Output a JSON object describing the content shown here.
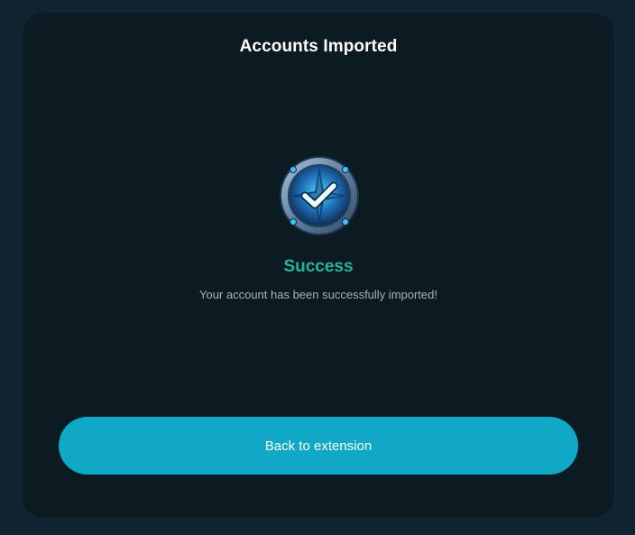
{
  "header": {
    "title": "Accounts Imported"
  },
  "status": {
    "icon": "verified-check-badge-icon",
    "heading": "Success",
    "message": "Your account has been successfully imported!",
    "accent_color": "#27b39a"
  },
  "actions": {
    "back_label": "Back to extension",
    "button_color": "#0fa9c7"
  }
}
